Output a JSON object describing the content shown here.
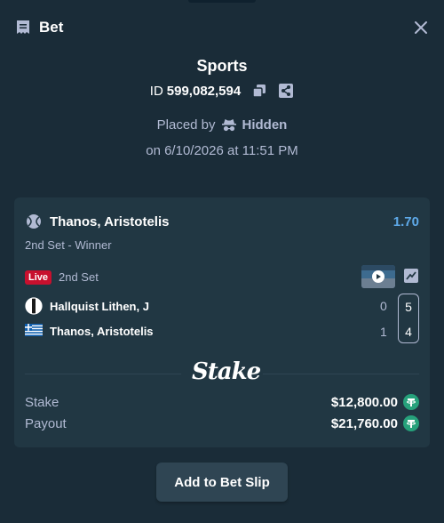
{
  "header": {
    "title": "Bet",
    "icon": "receipt-icon",
    "close_icon": "close-icon"
  },
  "summary": {
    "category": "Sports",
    "id_label": "ID",
    "id_value": "599,082,594",
    "placed_by_label": "Placed by",
    "placed_by_name": "Hidden",
    "datetime": "on 6/10/2026 at 11:51 PM"
  },
  "bet": {
    "selection": "Thanos, Aristotelis",
    "odds": "1.70",
    "market": "2nd Set - Winner",
    "live_badge": "Live",
    "period": "2nd Set",
    "players": [
      {
        "name": "Hallquist Lithen, J",
        "current_set_games": "0",
        "sets": "5"
      },
      {
        "name": "Thanos, Aristotelis",
        "current_set_games": "1",
        "sets": "4"
      }
    ],
    "logo": "Stake",
    "stake_label": "Stake",
    "stake_value": "$12,800.00",
    "payout_label": "Payout",
    "payout_value": "$21,760.00",
    "currency_icon": "tether-icon"
  },
  "actions": {
    "add_to_slip": "Add to Bet Slip"
  },
  "colors": {
    "background": "#1a2c38",
    "card": "#213743",
    "odds": "#5ea9e8",
    "live": "#c8102e",
    "tether": "#26a17b"
  }
}
